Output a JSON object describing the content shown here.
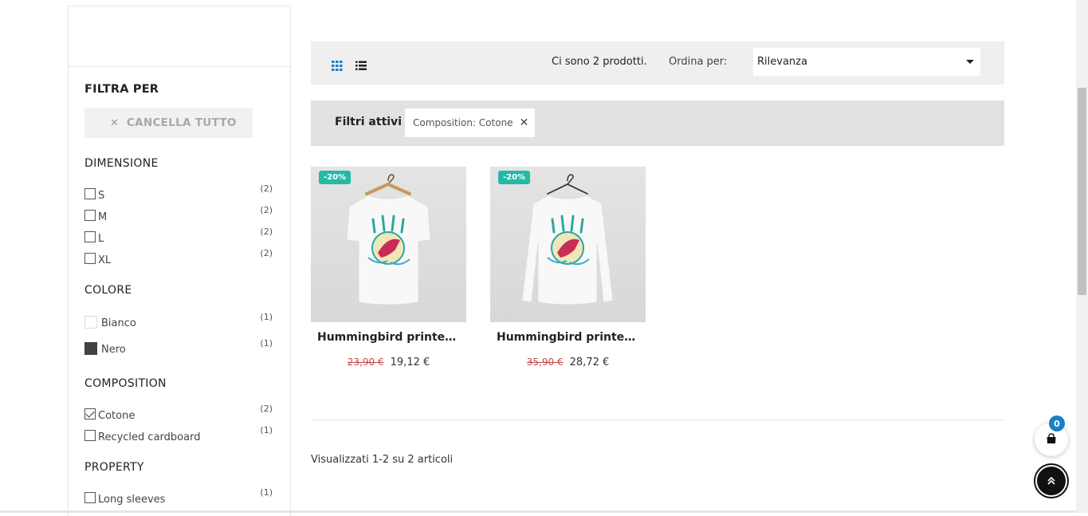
{
  "sidebar": {
    "filter_title": "FILTRA PER",
    "clear_all": "CANCELLA TUTTO",
    "dimensione": {
      "title": "DIMENSIONE",
      "items": [
        {
          "label": "S",
          "count": "(2)"
        },
        {
          "label": "M",
          "count": "(2)"
        },
        {
          "label": "L",
          "count": "(2)"
        },
        {
          "label": "XL",
          "count": "(2)"
        }
      ]
    },
    "colore": {
      "title": "COLORE",
      "items": [
        {
          "label": "Bianco",
          "count": "(1)",
          "color": "#ffffff"
        },
        {
          "label": "Nero",
          "count": "(1)",
          "color": "#434343"
        }
      ]
    },
    "composition": {
      "title": "COMPOSITION",
      "items": [
        {
          "label": "Cotone",
          "count": "(2)",
          "checked": true
        },
        {
          "label": "Recycled cardboard",
          "count": "(1)",
          "checked": false
        }
      ]
    },
    "property": {
      "title": "PROPERTY",
      "items": [
        {
          "label": "Long sleeves",
          "count": "(1)"
        }
      ]
    }
  },
  "toolbar": {
    "count_text": "Ci sono 2 prodotti.",
    "sort_label": "Ordina per:",
    "sort_value": "Rilevanza"
  },
  "active_filters": {
    "title": "Filtri attivi",
    "chip": "Composition: Cotone"
  },
  "products": [
    {
      "badge": "-20%",
      "name": "Hummingbird printed t-...",
      "old_price": "23,90 €",
      "new_price": "19,12 €"
    },
    {
      "badge": "-20%",
      "name": "Hummingbird printed...",
      "old_price": "35,90 €",
      "new_price": "28,72 €"
    }
  ],
  "pagination": {
    "showing": "Visualizzati 1-2 su 2 articoli"
  },
  "cart": {
    "count": "0"
  },
  "colors": {
    "accent_badge": "#24b9a6",
    "cart_badge": "#1a7fc4",
    "old_price": "#c14a4a"
  }
}
